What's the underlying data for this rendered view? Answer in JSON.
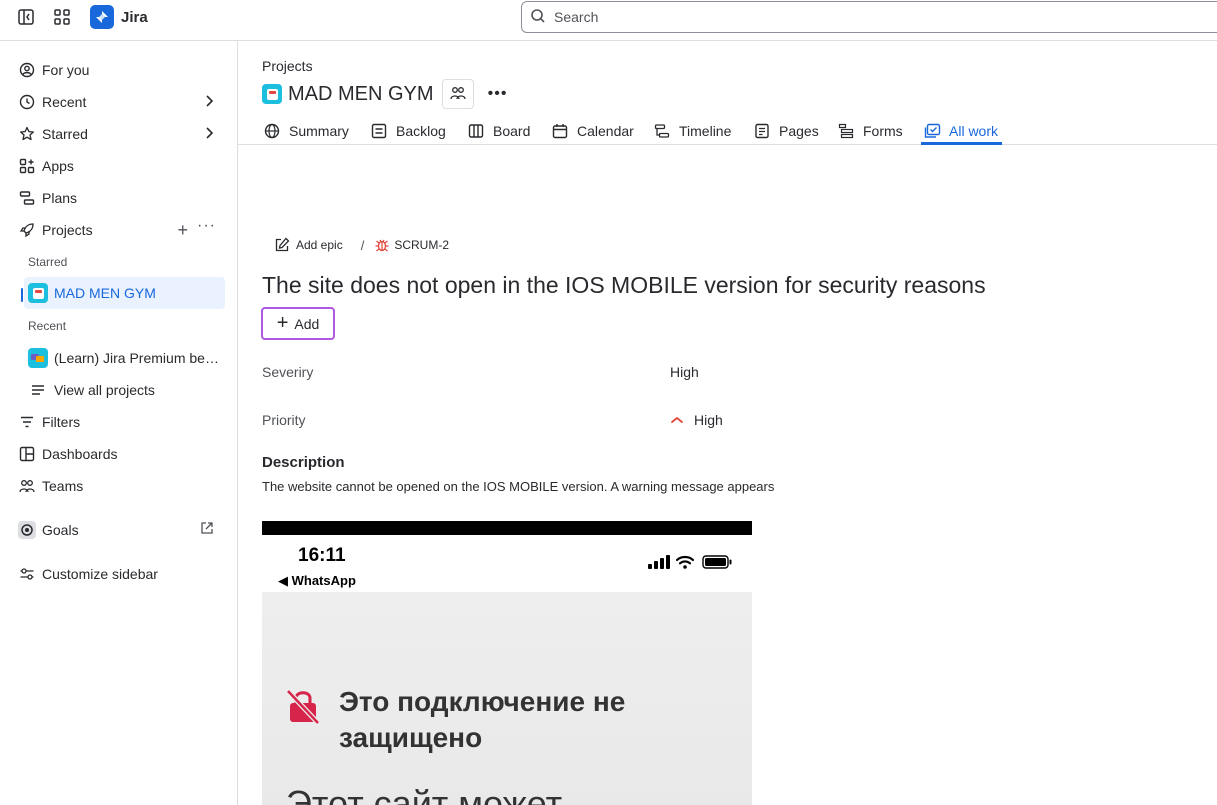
{
  "topbar": {
    "app_name": "Jira",
    "search_placeholder": "Search"
  },
  "sidebar": {
    "items": [
      {
        "label": "For you"
      },
      {
        "label": "Recent"
      },
      {
        "label": "Starred"
      },
      {
        "label": "Apps"
      },
      {
        "label": "Plans"
      },
      {
        "label": "Projects"
      },
      {
        "label": "View all projects"
      },
      {
        "label": "Filters"
      },
      {
        "label": "Dashboards"
      },
      {
        "label": "Teams"
      },
      {
        "label": "Goals"
      },
      {
        "label": "Customize sidebar"
      }
    ],
    "sections": {
      "starred": "Starred",
      "recent": "Recent"
    },
    "starred_projects": [
      {
        "label": "MAD MEN GYM"
      }
    ],
    "recent_projects": [
      {
        "label": "(Learn) Jira Premium benefits"
      }
    ]
  },
  "header": {
    "breadcrumb": "Projects",
    "project_name": "MAD MEN GYM"
  },
  "tabs": [
    {
      "label": "Summary",
      "icon": "globe-icon"
    },
    {
      "label": "Backlog",
      "icon": "backlog-icon"
    },
    {
      "label": "Board",
      "icon": "board-icon"
    },
    {
      "label": "Calendar",
      "icon": "calendar-icon"
    },
    {
      "label": "Timeline",
      "icon": "timeline-icon"
    },
    {
      "label": "Pages",
      "icon": "pages-icon"
    },
    {
      "label": "Forms",
      "icon": "forms-icon"
    },
    {
      "label": "All work",
      "icon": "all-work-icon",
      "active": true
    }
  ],
  "issue": {
    "add_epic": "Add epic",
    "separator": "/",
    "key": "SCRUM-2",
    "title": "The site does not open in the IOS MOBILE version for security reasons",
    "add_button": "Add",
    "fields": [
      {
        "label": "Severiry",
        "value": "High"
      },
      {
        "label": "Priority",
        "value": "High"
      }
    ],
    "description_title": "Description",
    "description_text": "The website cannot be opened on the IOS MOBILE version. A warning message appears"
  },
  "attachment": {
    "time": "16:11",
    "back_label": "◀ WhatsApp",
    "warning_title": "Это подключение не защищено",
    "warning_subtitle": "Этот сайт может"
  },
  "colors": {
    "accent": "#1868db",
    "selected_bg": "#e9f2fe",
    "focus_outline": "#af59e1",
    "priority_high": "#e2483d",
    "bug_icon": "#e2483d"
  }
}
